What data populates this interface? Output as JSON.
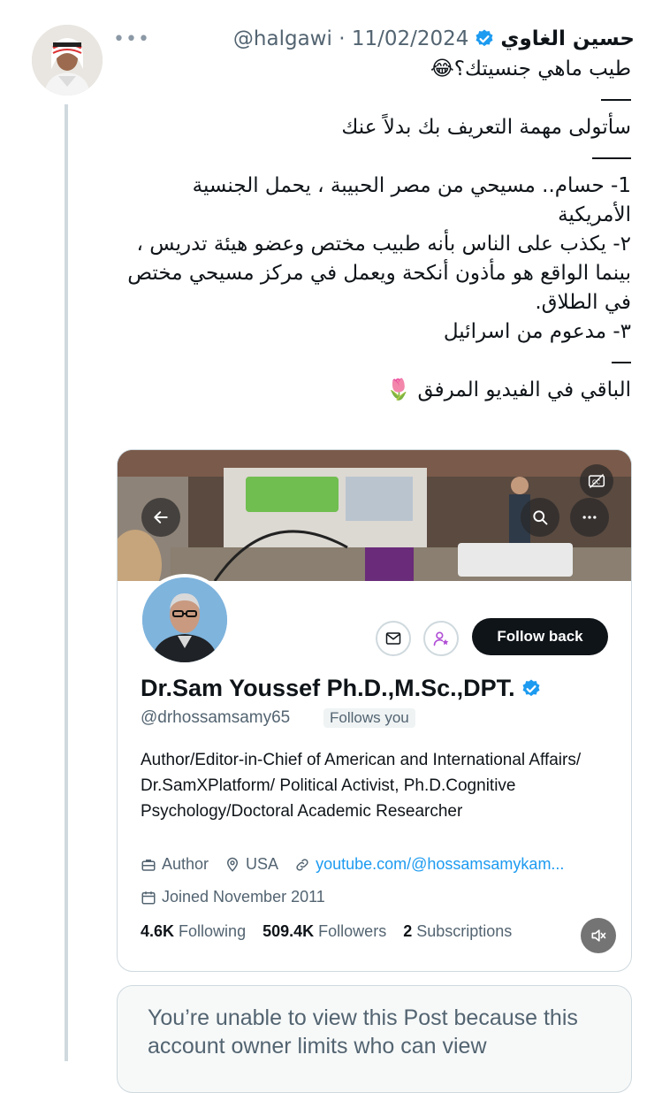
{
  "tweet": {
    "author_name": "حسين الغاوي",
    "handle": "@halgawi",
    "separator": "·",
    "date": "11/02/2024",
    "more_icon": "more-horizontal-icon",
    "lines": [
      "طيب ماهي جنسيتك؟😂",
      "سأتولى مهمة التعريف بك بدلاً عنك",
      "1- حسام.. مسيحي من مصر الحبيبة ، يحمل الجنسية الأمريكية",
      "٢- يكذب على الناس بأنه طبيب مختص وعضو هيئة تدريس ، بينما الواقع هو مأذون أنكحة ويعمل في مركز مسيحي مختص في الطلاق.",
      "٣- مدعوم من اسرائيل",
      "الباقي في الفيديو المرفق 🌷"
    ]
  },
  "profile_card": {
    "name": "Dr.Sam Youssef Ph.D.,M.Sc.,DPT.",
    "handle": "@drhossamsamy65",
    "follows_you": "Follows you",
    "follow_back_label": "Follow back",
    "bio": "Author/Editor-in-Chief of American and International Affairs/ Dr.SamXPlatform/ Political Activist, Ph.D.Cognitive Psychology/Doctoral Academic Researcher",
    "occupation": "Author",
    "location": "USA",
    "website": "youtube.com/@hossamsamykam...",
    "joined": "Joined November 2011",
    "following_count": "4.6K",
    "following_label": "Following",
    "followers_count": "509.4K",
    "followers_label": "Followers",
    "subscriptions_count": "2",
    "subscriptions_label": "Subscriptions"
  },
  "unavailable_notice": "You’re unable to view this Post because this account owner limits who can view",
  "colors": {
    "accent_blue": "#1d9bf0",
    "text_primary": "#0f1419",
    "text_secondary": "#536471",
    "border": "#cfd9de",
    "follow_button_bg": "#0f1419",
    "subscribe_icon_purple": "#b14fd6"
  }
}
